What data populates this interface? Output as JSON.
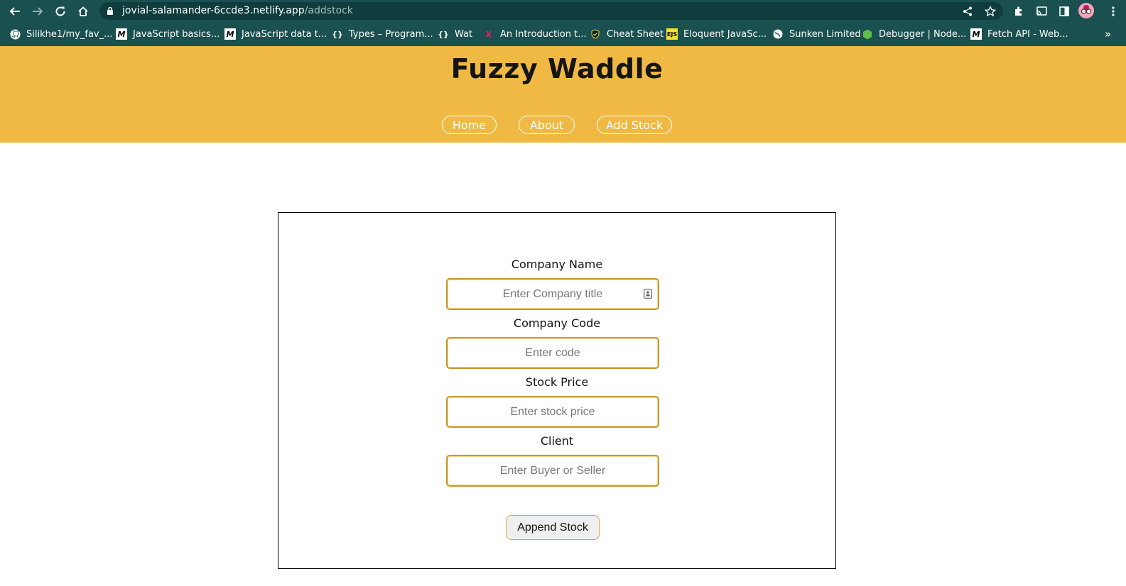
{
  "browser": {
    "url_host": "jovial-salamander-6ccde3.netlify.app",
    "url_path": "/addstock",
    "bookmarks": [
      {
        "label": "Silikhe1/my_fav_..."
      },
      {
        "label": "JavaScript basics..."
      },
      {
        "label": "JavaScript data t..."
      },
      {
        "label": "Types – Program..."
      },
      {
        "label": "Wat"
      },
      {
        "label": "An Introduction t..."
      },
      {
        "label": "Cheat Sheet"
      },
      {
        "label": "Eloquent JavaSc..."
      },
      {
        "label": "Sunken Limited"
      },
      {
        "label": "Debugger | Node..."
      },
      {
        "label": "Fetch API - Web..."
      }
    ],
    "more_label": "»",
    "eloquent_favicon_text": "EJS"
  },
  "site": {
    "title": "Fuzzy Waddle",
    "nav": [
      "Home",
      "About",
      "Add Stock"
    ],
    "header_color": "#f0b944"
  },
  "form": {
    "fields": [
      {
        "label": "Company Name",
        "placeholder": "Enter Company title",
        "value": ""
      },
      {
        "label": "Company Code",
        "placeholder": "Enter code",
        "value": ""
      },
      {
        "label": "Stock Price",
        "placeholder": "Enter stock price",
        "value": ""
      },
      {
        "label": "Client",
        "placeholder": "Enter Buyer or Seller",
        "value": ""
      }
    ],
    "submit_label": "Append Stock",
    "accent_color": "#c69a2e"
  }
}
